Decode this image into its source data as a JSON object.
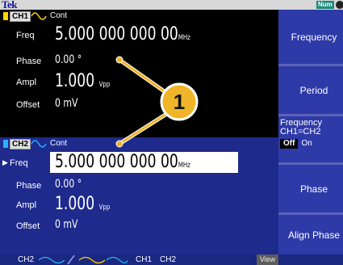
{
  "header": {
    "brand": "Tek",
    "num_badge": "Num"
  },
  "ch1": {
    "tag": "CH1",
    "mode": "Cont",
    "freq_label": "Freq",
    "freq_value": "5.000 000 000 00",
    "freq_unit": "MHz",
    "phase_label": "Phase",
    "phase_value": "0.00 °",
    "ampl_label": "Ampl",
    "ampl_value": "1.000",
    "ampl_unit": "Vpp",
    "offset_label": "Offset",
    "offset_value": "0 mV"
  },
  "ch2": {
    "tag": "CH2",
    "mode": "Cont",
    "freq_marker": "▶",
    "freq_label": "Freq",
    "freq_value": "5.000 000 000 00",
    "freq_unit": "MHz",
    "phase_label": "Phase",
    "phase_value": "0.00 °",
    "ampl_label": "Ampl",
    "ampl_value": "1.000",
    "ampl_unit": "Vpp",
    "offset_label": "Offset",
    "offset_value": "0 mV"
  },
  "softkeys": {
    "frequency": "Frequency",
    "period": "Period",
    "freq_equal_line1": "Frequency",
    "freq_equal_line2": "CH1=CH2",
    "off": "Off",
    "on": "On",
    "phase": "Phase",
    "align_phase": "Align Phase"
  },
  "bottombar": {
    "ch2": "CH2",
    "ch1": "CH1",
    "ch2b": "CH2",
    "view": "View"
  },
  "callout": {
    "number": "1"
  },
  "colors": {
    "ch1": "#ffd400",
    "ch2": "#2ab0ff",
    "panel_blue": "#1e2a8c",
    "softkey_blue": "#2e3aa8",
    "callout_gold": "#f0b429"
  }
}
